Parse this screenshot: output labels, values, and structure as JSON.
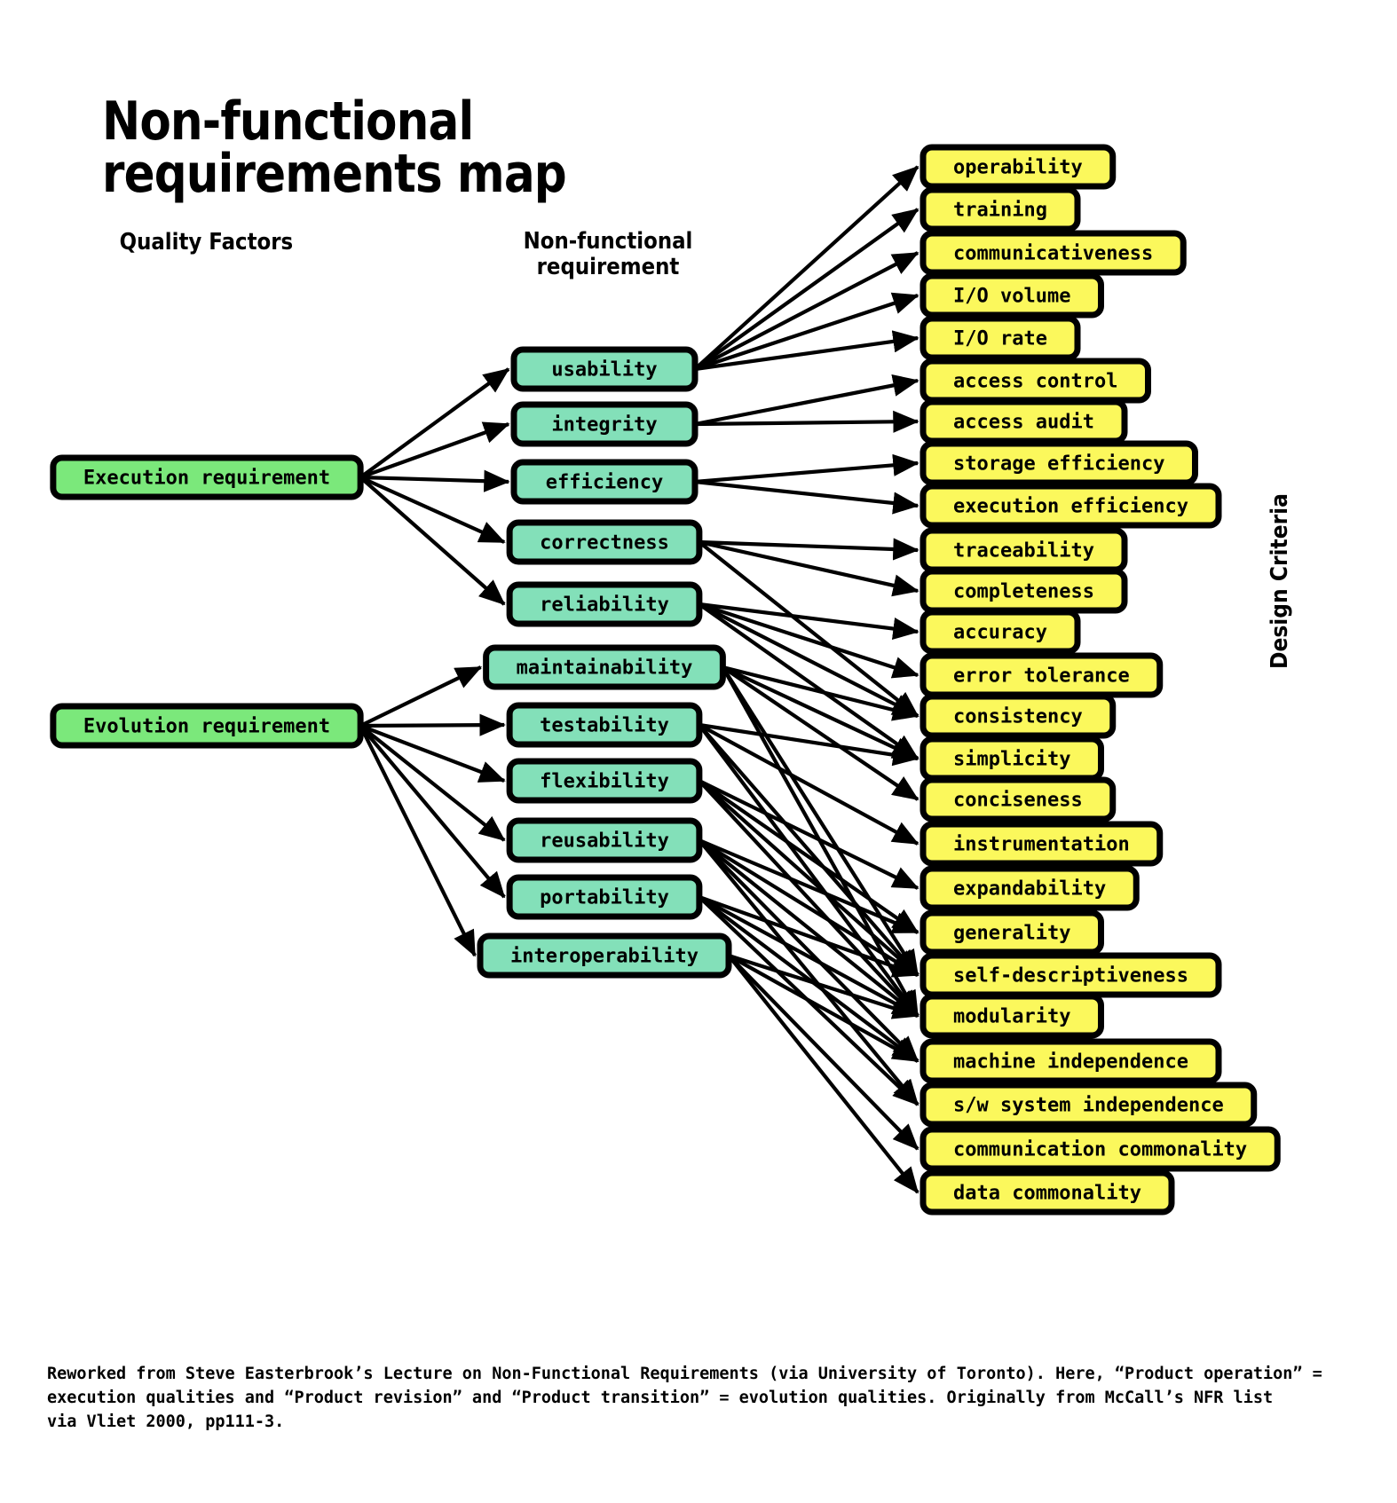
{
  "title": "Non-functional requirements map",
  "column_headers": {
    "quality_factors": "Quality Factors",
    "nfr": "Non-functional\nrequirement",
    "design_criteria": "Design Criteria"
  },
  "colors": {
    "quality_factor_fill": "#7BE87B",
    "nfr_fill": "#83E0B9",
    "design_criteria_fill": "#FBF85C",
    "stroke": "#000000",
    "background": "#FFFFFF"
  },
  "quality_factors": [
    {
      "id": "execution",
      "label": "Execution requirement"
    },
    {
      "id": "evolution",
      "label": "Evolution requirement"
    }
  ],
  "nfrs": [
    {
      "id": "usability",
      "label": "usability"
    },
    {
      "id": "integrity",
      "label": "integrity"
    },
    {
      "id": "efficiency",
      "label": "efficiency"
    },
    {
      "id": "correctness",
      "label": "correctness"
    },
    {
      "id": "reliability",
      "label": "reliability"
    },
    {
      "id": "maintainability",
      "label": "maintainability"
    },
    {
      "id": "testability",
      "label": "testability"
    },
    {
      "id": "flexibility",
      "label": "flexibility"
    },
    {
      "id": "reusability",
      "label": "reusability"
    },
    {
      "id": "portability",
      "label": "portability"
    },
    {
      "id": "interoperability",
      "label": "interoperability"
    }
  ],
  "design_criteria": [
    {
      "id": "operability",
      "label": "operability"
    },
    {
      "id": "training",
      "label": "training"
    },
    {
      "id": "communicativeness",
      "label": "communicativeness"
    },
    {
      "id": "io_volume",
      "label": "I/O volume"
    },
    {
      "id": "io_rate",
      "label": "I/O rate"
    },
    {
      "id": "access_control",
      "label": "access control"
    },
    {
      "id": "access_audit",
      "label": "access audit"
    },
    {
      "id": "storage_efficiency",
      "label": "storage efficiency"
    },
    {
      "id": "execution_efficiency",
      "label": "execution efficiency"
    },
    {
      "id": "traceability",
      "label": "traceability"
    },
    {
      "id": "completeness",
      "label": "completeness"
    },
    {
      "id": "accuracy",
      "label": "accuracy"
    },
    {
      "id": "error_tolerance",
      "label": "error tolerance"
    },
    {
      "id": "consistency",
      "label": "consistency"
    },
    {
      "id": "simplicity",
      "label": "simplicity"
    },
    {
      "id": "conciseness",
      "label": "conciseness"
    },
    {
      "id": "instrumentation",
      "label": "instrumentation"
    },
    {
      "id": "expandability",
      "label": "expandability"
    },
    {
      "id": "generality",
      "label": "generality"
    },
    {
      "id": "self_descriptiveness",
      "label": "self-descriptiveness"
    },
    {
      "id": "modularity",
      "label": "modularity"
    },
    {
      "id": "machine_independence",
      "label": "machine independence"
    },
    {
      "id": "sw_system_independence",
      "label": "s/w system independence"
    },
    {
      "id": "communication_commonality",
      "label": "communication commonality"
    },
    {
      "id": "data_commonality",
      "label": "data commonality"
    }
  ],
  "edges_factor_to_nfr": [
    {
      "from": "execution",
      "to": "usability"
    },
    {
      "from": "execution",
      "to": "integrity"
    },
    {
      "from": "execution",
      "to": "efficiency"
    },
    {
      "from": "execution",
      "to": "correctness"
    },
    {
      "from": "execution",
      "to": "reliability"
    },
    {
      "from": "evolution",
      "to": "maintainability"
    },
    {
      "from": "evolution",
      "to": "testability"
    },
    {
      "from": "evolution",
      "to": "flexibility"
    },
    {
      "from": "evolution",
      "to": "reusability"
    },
    {
      "from": "evolution",
      "to": "portability"
    },
    {
      "from": "evolution",
      "to": "interoperability"
    }
  ],
  "edges_nfr_to_criteria": [
    {
      "from": "usability",
      "to": "operability"
    },
    {
      "from": "usability",
      "to": "training"
    },
    {
      "from": "usability",
      "to": "communicativeness"
    },
    {
      "from": "usability",
      "to": "io_volume"
    },
    {
      "from": "usability",
      "to": "io_rate"
    },
    {
      "from": "integrity",
      "to": "access_control"
    },
    {
      "from": "integrity",
      "to": "access_audit"
    },
    {
      "from": "efficiency",
      "to": "storage_efficiency"
    },
    {
      "from": "efficiency",
      "to": "execution_efficiency"
    },
    {
      "from": "correctness",
      "to": "traceability"
    },
    {
      "from": "correctness",
      "to": "completeness"
    },
    {
      "from": "correctness",
      "to": "consistency"
    },
    {
      "from": "reliability",
      "to": "accuracy"
    },
    {
      "from": "reliability",
      "to": "error_tolerance"
    },
    {
      "from": "reliability",
      "to": "consistency"
    },
    {
      "from": "reliability",
      "to": "simplicity"
    },
    {
      "from": "maintainability",
      "to": "consistency"
    },
    {
      "from": "maintainability",
      "to": "simplicity"
    },
    {
      "from": "maintainability",
      "to": "conciseness"
    },
    {
      "from": "maintainability",
      "to": "modularity"
    },
    {
      "from": "maintainability",
      "to": "self_descriptiveness"
    },
    {
      "from": "testability",
      "to": "simplicity"
    },
    {
      "from": "testability",
      "to": "instrumentation"
    },
    {
      "from": "testability",
      "to": "modularity"
    },
    {
      "from": "testability",
      "to": "self_descriptiveness"
    },
    {
      "from": "flexibility",
      "to": "expandability"
    },
    {
      "from": "flexibility",
      "to": "generality"
    },
    {
      "from": "flexibility",
      "to": "modularity"
    },
    {
      "from": "flexibility",
      "to": "self_descriptiveness"
    },
    {
      "from": "reusability",
      "to": "generality"
    },
    {
      "from": "reusability",
      "to": "modularity"
    },
    {
      "from": "reusability",
      "to": "self_descriptiveness"
    },
    {
      "from": "reusability",
      "to": "machine_independence"
    },
    {
      "from": "reusability",
      "to": "sw_system_independence"
    },
    {
      "from": "portability",
      "to": "modularity"
    },
    {
      "from": "portability",
      "to": "self_descriptiveness"
    },
    {
      "from": "portability",
      "to": "machine_independence"
    },
    {
      "from": "portability",
      "to": "sw_system_independence"
    },
    {
      "from": "interoperability",
      "to": "modularity"
    },
    {
      "from": "interoperability",
      "to": "machine_independence"
    },
    {
      "from": "interoperability",
      "to": "communication_commonality"
    },
    {
      "from": "interoperability",
      "to": "data_commonality"
    }
  ],
  "footer": "Reworked from Steve Easterbrook’s Lecture on Non-Functional Requirements (via University of Toronto). Here, “Product operation” =\nexecution qualities and “Product revision” and “Product transition” = evolution qualities. Originally from McCall’s NFR list\nvia Vliet 2000, pp111-3."
}
